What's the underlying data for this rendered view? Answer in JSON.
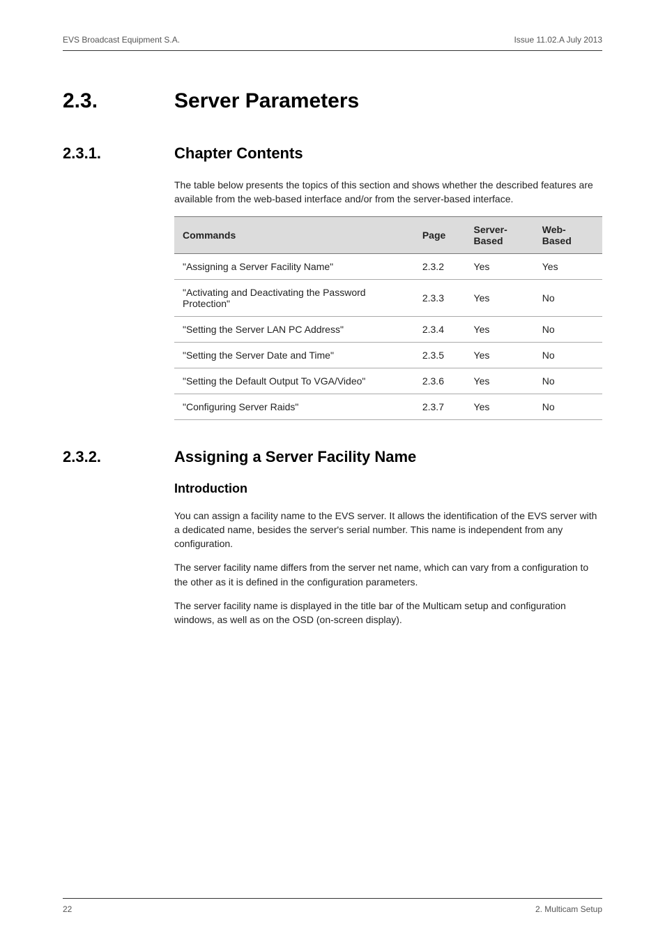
{
  "header": {
    "left": "EVS Broadcast Equipment S.A.",
    "right": "Issue 11.02.A  July 2013"
  },
  "h1": {
    "num": "2.3.",
    "text": "Server Parameters"
  },
  "s231": {
    "num": "2.3.1.",
    "title": "Chapter Contents",
    "intro": "The table below presents the topics of this section and shows whether the described features are available from the web-based interface and/or from the server-based interface.",
    "table": {
      "headers": [
        "Commands",
        "Page",
        "Server-Based",
        "Web-Based"
      ],
      "rows": [
        [
          "\"Assigning a Server Facility Name\"",
          "2.3.2",
          "Yes",
          "Yes"
        ],
        [
          "\"Activating and Deactivating the Password Protection\"",
          "2.3.3",
          "Yes",
          "No"
        ],
        [
          "\"Setting the Server LAN PC Address\"",
          "2.3.4",
          "Yes",
          "No"
        ],
        [
          "\"Setting the Server Date and Time\"",
          "2.3.5",
          "Yes",
          "No"
        ],
        [
          "\"Setting the Default Output To VGA/Video\"",
          "2.3.6",
          "Yes",
          "No"
        ],
        [
          "\"Configuring Server Raids\"",
          "2.3.7",
          "Yes",
          "No"
        ]
      ]
    }
  },
  "s232": {
    "num": "2.3.2.",
    "title": "Assigning a Server Facility Name",
    "intro_heading": "Introduction",
    "p1": "You can assign a facility name to the EVS server. It allows the identification of the EVS server with a dedicated name, besides the server's serial number. This name is independent from any configuration.",
    "p2": "The server facility name differs from the server net name, which can vary from a configuration to the other as it is defined in the configuration parameters.",
    "p3": "The server facility name is displayed in the title bar of the Multicam setup and configuration windows, as well as on the OSD (on-screen display)."
  },
  "footer": {
    "left": "22",
    "right": "2. Multicam Setup"
  }
}
